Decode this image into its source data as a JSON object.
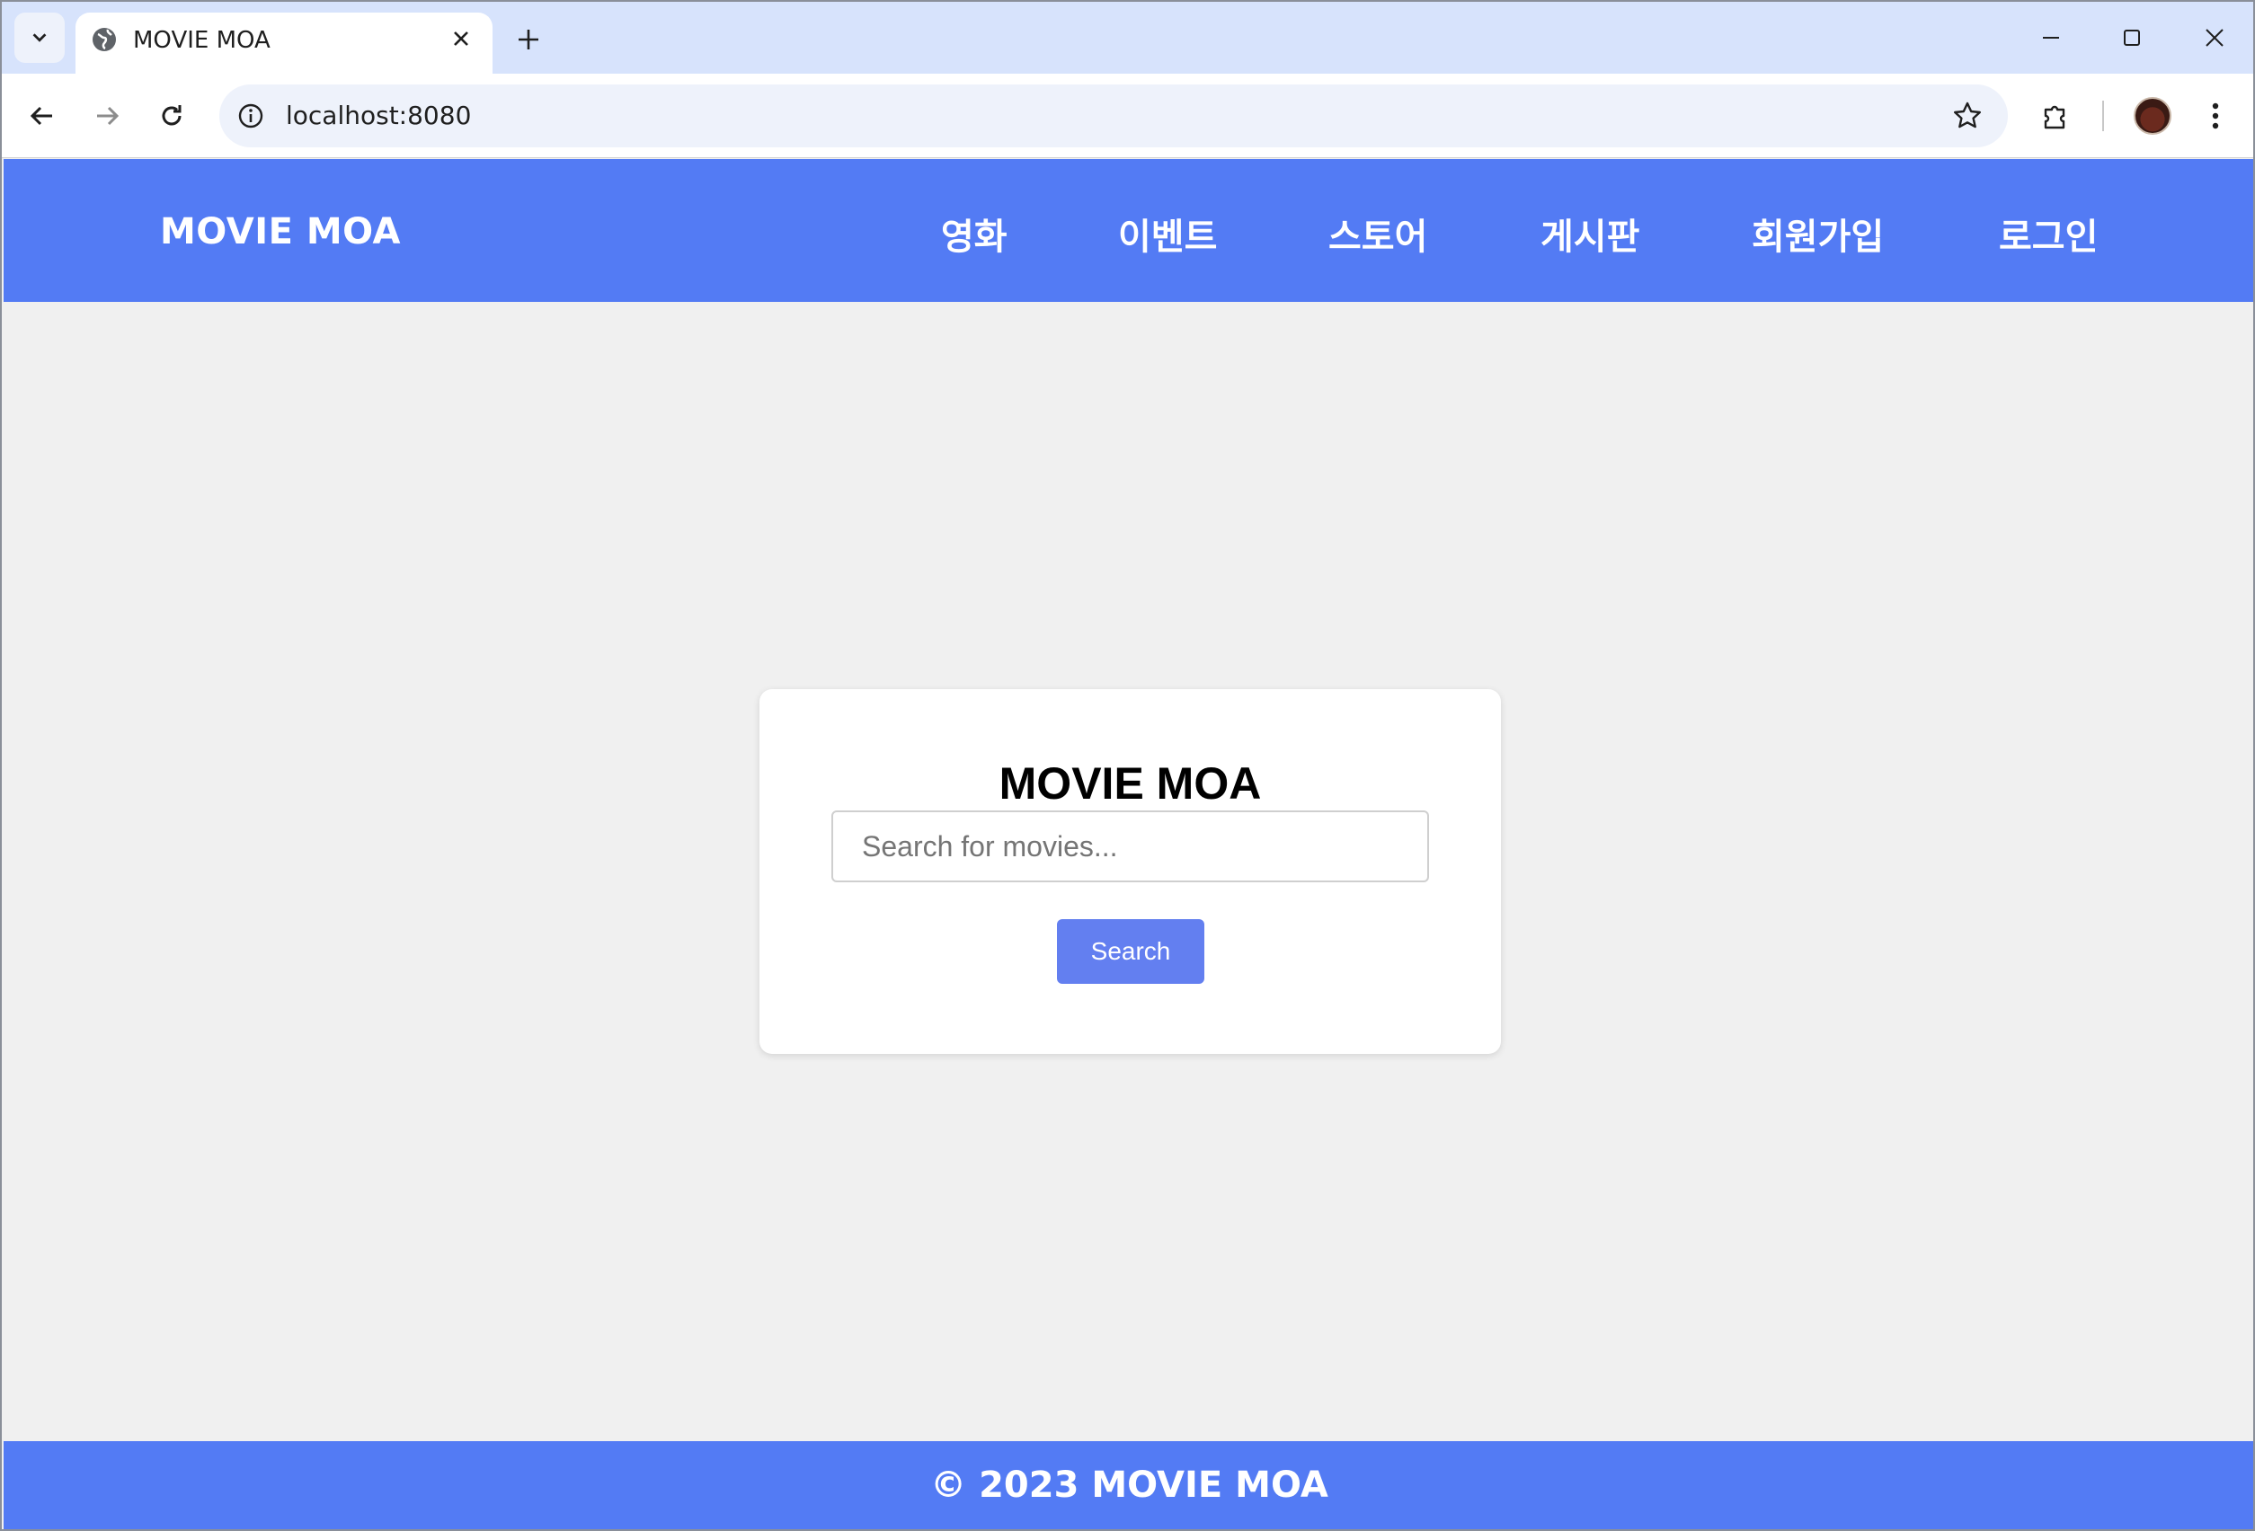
{
  "browser": {
    "tab_title": "MOVIE MOA",
    "url": "localhost:8080"
  },
  "site": {
    "brand": "MOVIE MOA",
    "nav": [
      {
        "label": "영화"
      },
      {
        "label": "이벤트"
      },
      {
        "label": "스토어"
      },
      {
        "label": "게시판"
      },
      {
        "label": "회원가입"
      },
      {
        "label": "로그인"
      }
    ]
  },
  "search": {
    "title": "MOVIE MOA",
    "placeholder": "Search for movies...",
    "value": "",
    "button_label": "Search"
  },
  "footer": {
    "text": "© 2023 MOVIE MOA"
  },
  "colors": {
    "header": "#537bf4",
    "button": "#637ff0",
    "background": "#f0f0f0"
  }
}
